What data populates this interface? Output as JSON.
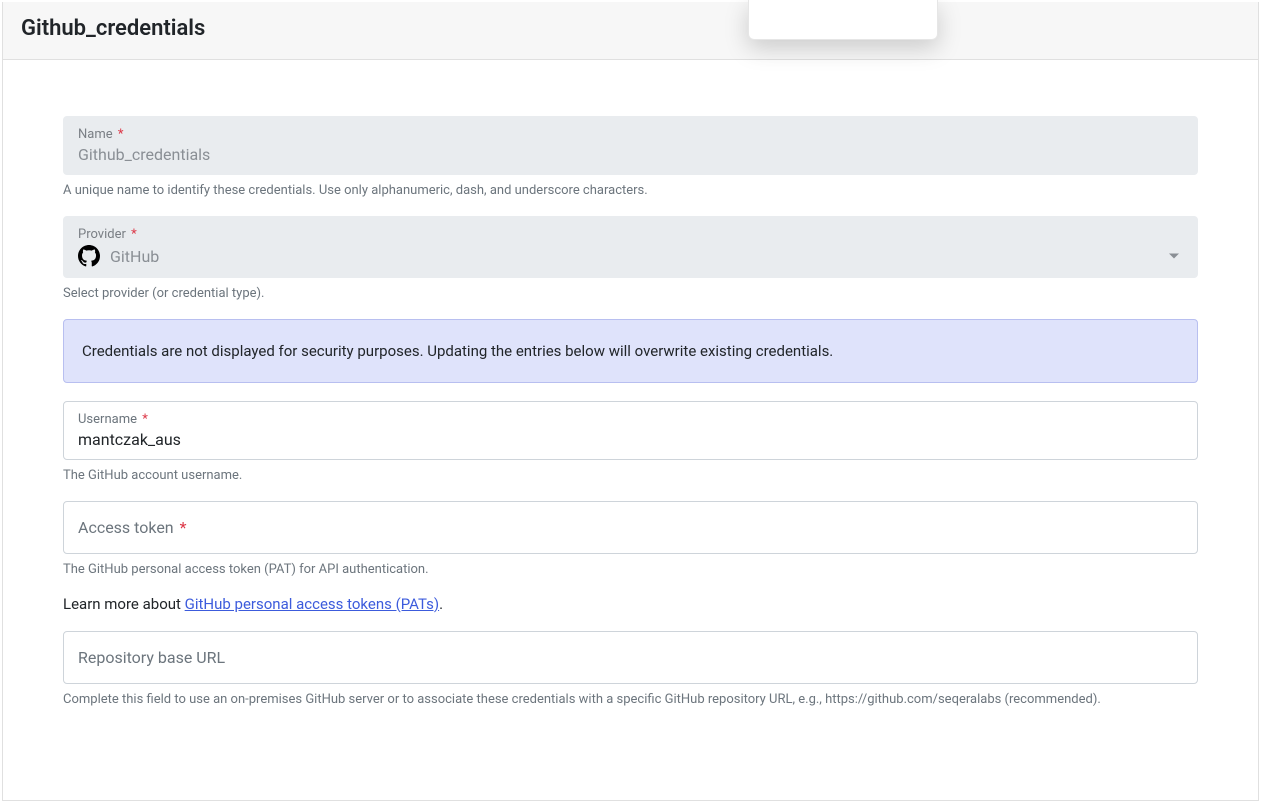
{
  "header": {
    "title": "Github_credentials"
  },
  "fields": {
    "name": {
      "label": "Name",
      "value": "Github_credentials",
      "help": "A unique name to identify these credentials. Use only alphanumeric, dash, and underscore characters."
    },
    "provider": {
      "label": "Provider",
      "value": "GitHub",
      "help": "Select provider (or credential type)."
    },
    "username": {
      "label": "Username",
      "value": "mantczak_aus",
      "help": "The GitHub account username."
    },
    "access_token": {
      "label": "Access token",
      "value": "",
      "help": "The GitHub personal access token (PAT) for API authentication."
    },
    "repo_base_url": {
      "label": "Repository base URL",
      "value": "",
      "help": "Complete this field to use an on-premises GitHub server or to associate these credentials with a specific GitHub repository URL, e.g., https://github.com/seqeralabs (recommended)."
    }
  },
  "banner": {
    "text": "Credentials are not displayed for security purposes. Updating the entries below will overwrite existing credentials."
  },
  "learn_more": {
    "prefix": "Learn more about ",
    "link_text": "GitHub personal access tokens (PATs)",
    "suffix": "."
  },
  "required_marker": "*"
}
